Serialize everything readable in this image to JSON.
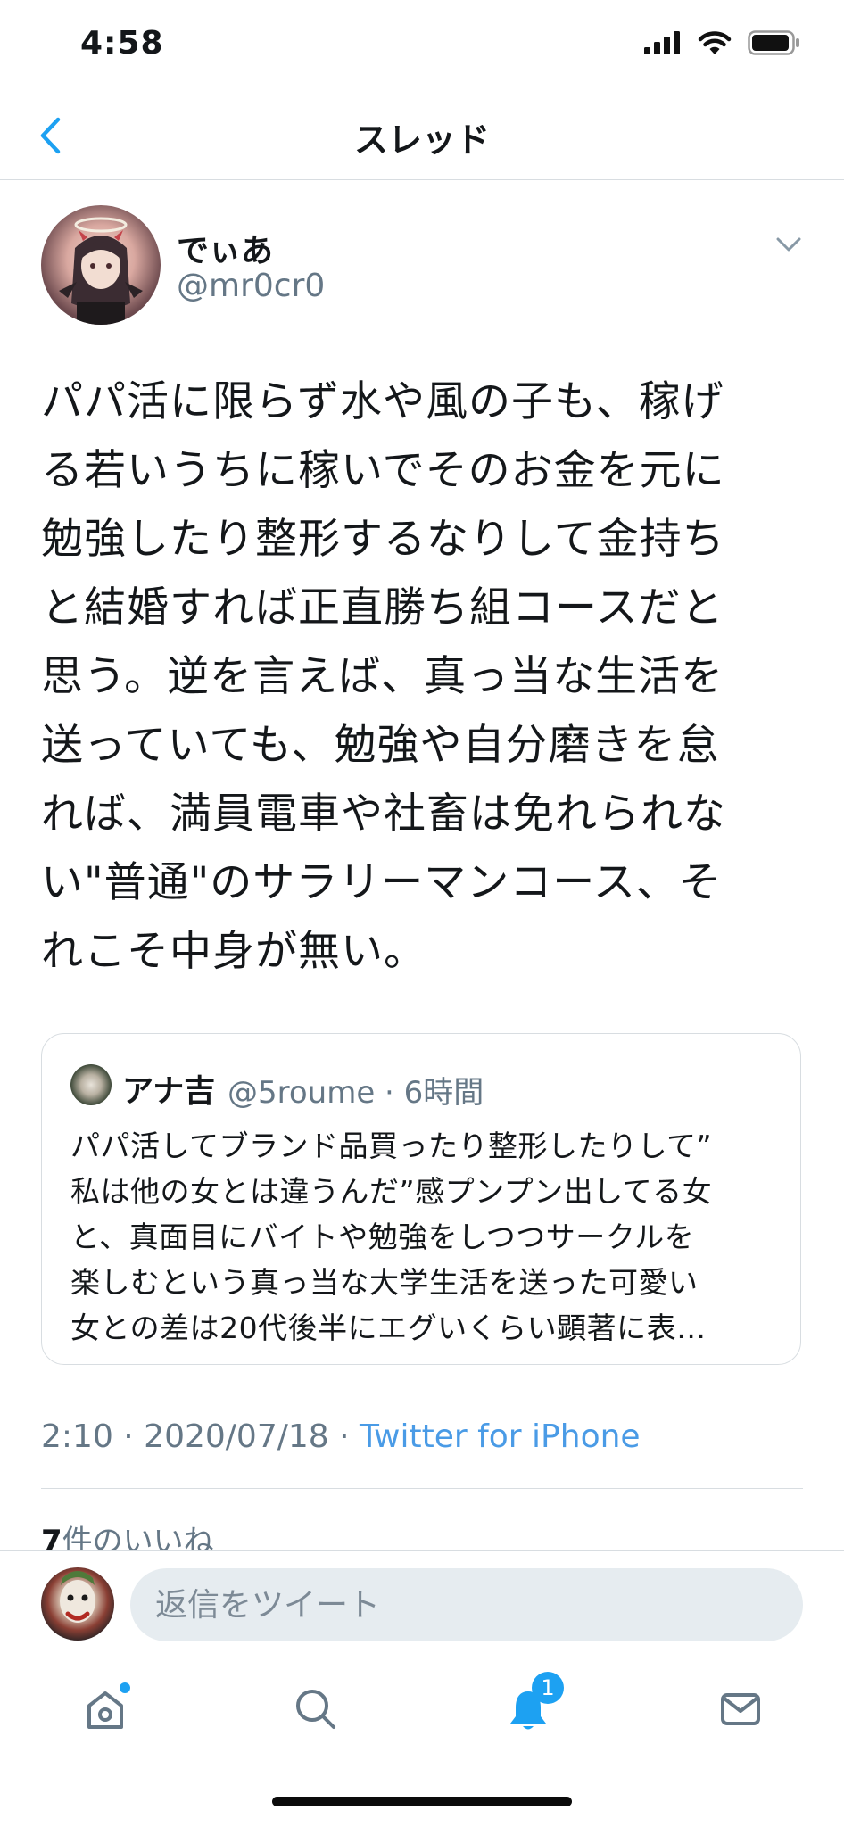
{
  "status_bar": {
    "time": "4:58"
  },
  "nav": {
    "title": "スレッド"
  },
  "tweet": {
    "display_name": "でぃあ",
    "handle": "@mr0cr0",
    "text": "パパ活に限らず水や風の子も、稼げ\nる若いうちに稼いでそのお金を元に\n勉強したり整形するなりして金持ち\nと結婚すれば正直勝ち組コースだと\n思う。逆を言えば、真っ当な生活を\n送っていても、勉強や自分磨きを怠\nれば、満員電車や社畜は免れられな\nい\"普通\"のサラリーマンコース、そ\nれこそ中身が無い。",
    "quote": {
      "name": "アナ吉",
      "meta": "@5roume · 6時間",
      "text": "パパ活してブランド品買ったり整形したりして”\n私は他の女とは違うんだ”感プンプン出してる女\nと、真面目にバイトや勉強をしつつサークルを\n楽しむという真っ当な大学生活を送った可愛い\n女との差は20代後半にエグいくらい顕著に表…"
    },
    "time": "2:10 · 2020/07/18 · ",
    "source": "Twitter for iPhone",
    "likes_count": "7",
    "likes_label": "件のいいね"
  },
  "reply": {
    "placeholder": "返信をツイート"
  },
  "tabs": {
    "home": "home-icon",
    "search": "search-icon",
    "notifications": "bell-icon",
    "notifications_badge": "1",
    "messages": "mail-icon"
  },
  "colors": {
    "accent": "#1da1f2",
    "muted": "#657786",
    "link": "#4a9be6"
  }
}
